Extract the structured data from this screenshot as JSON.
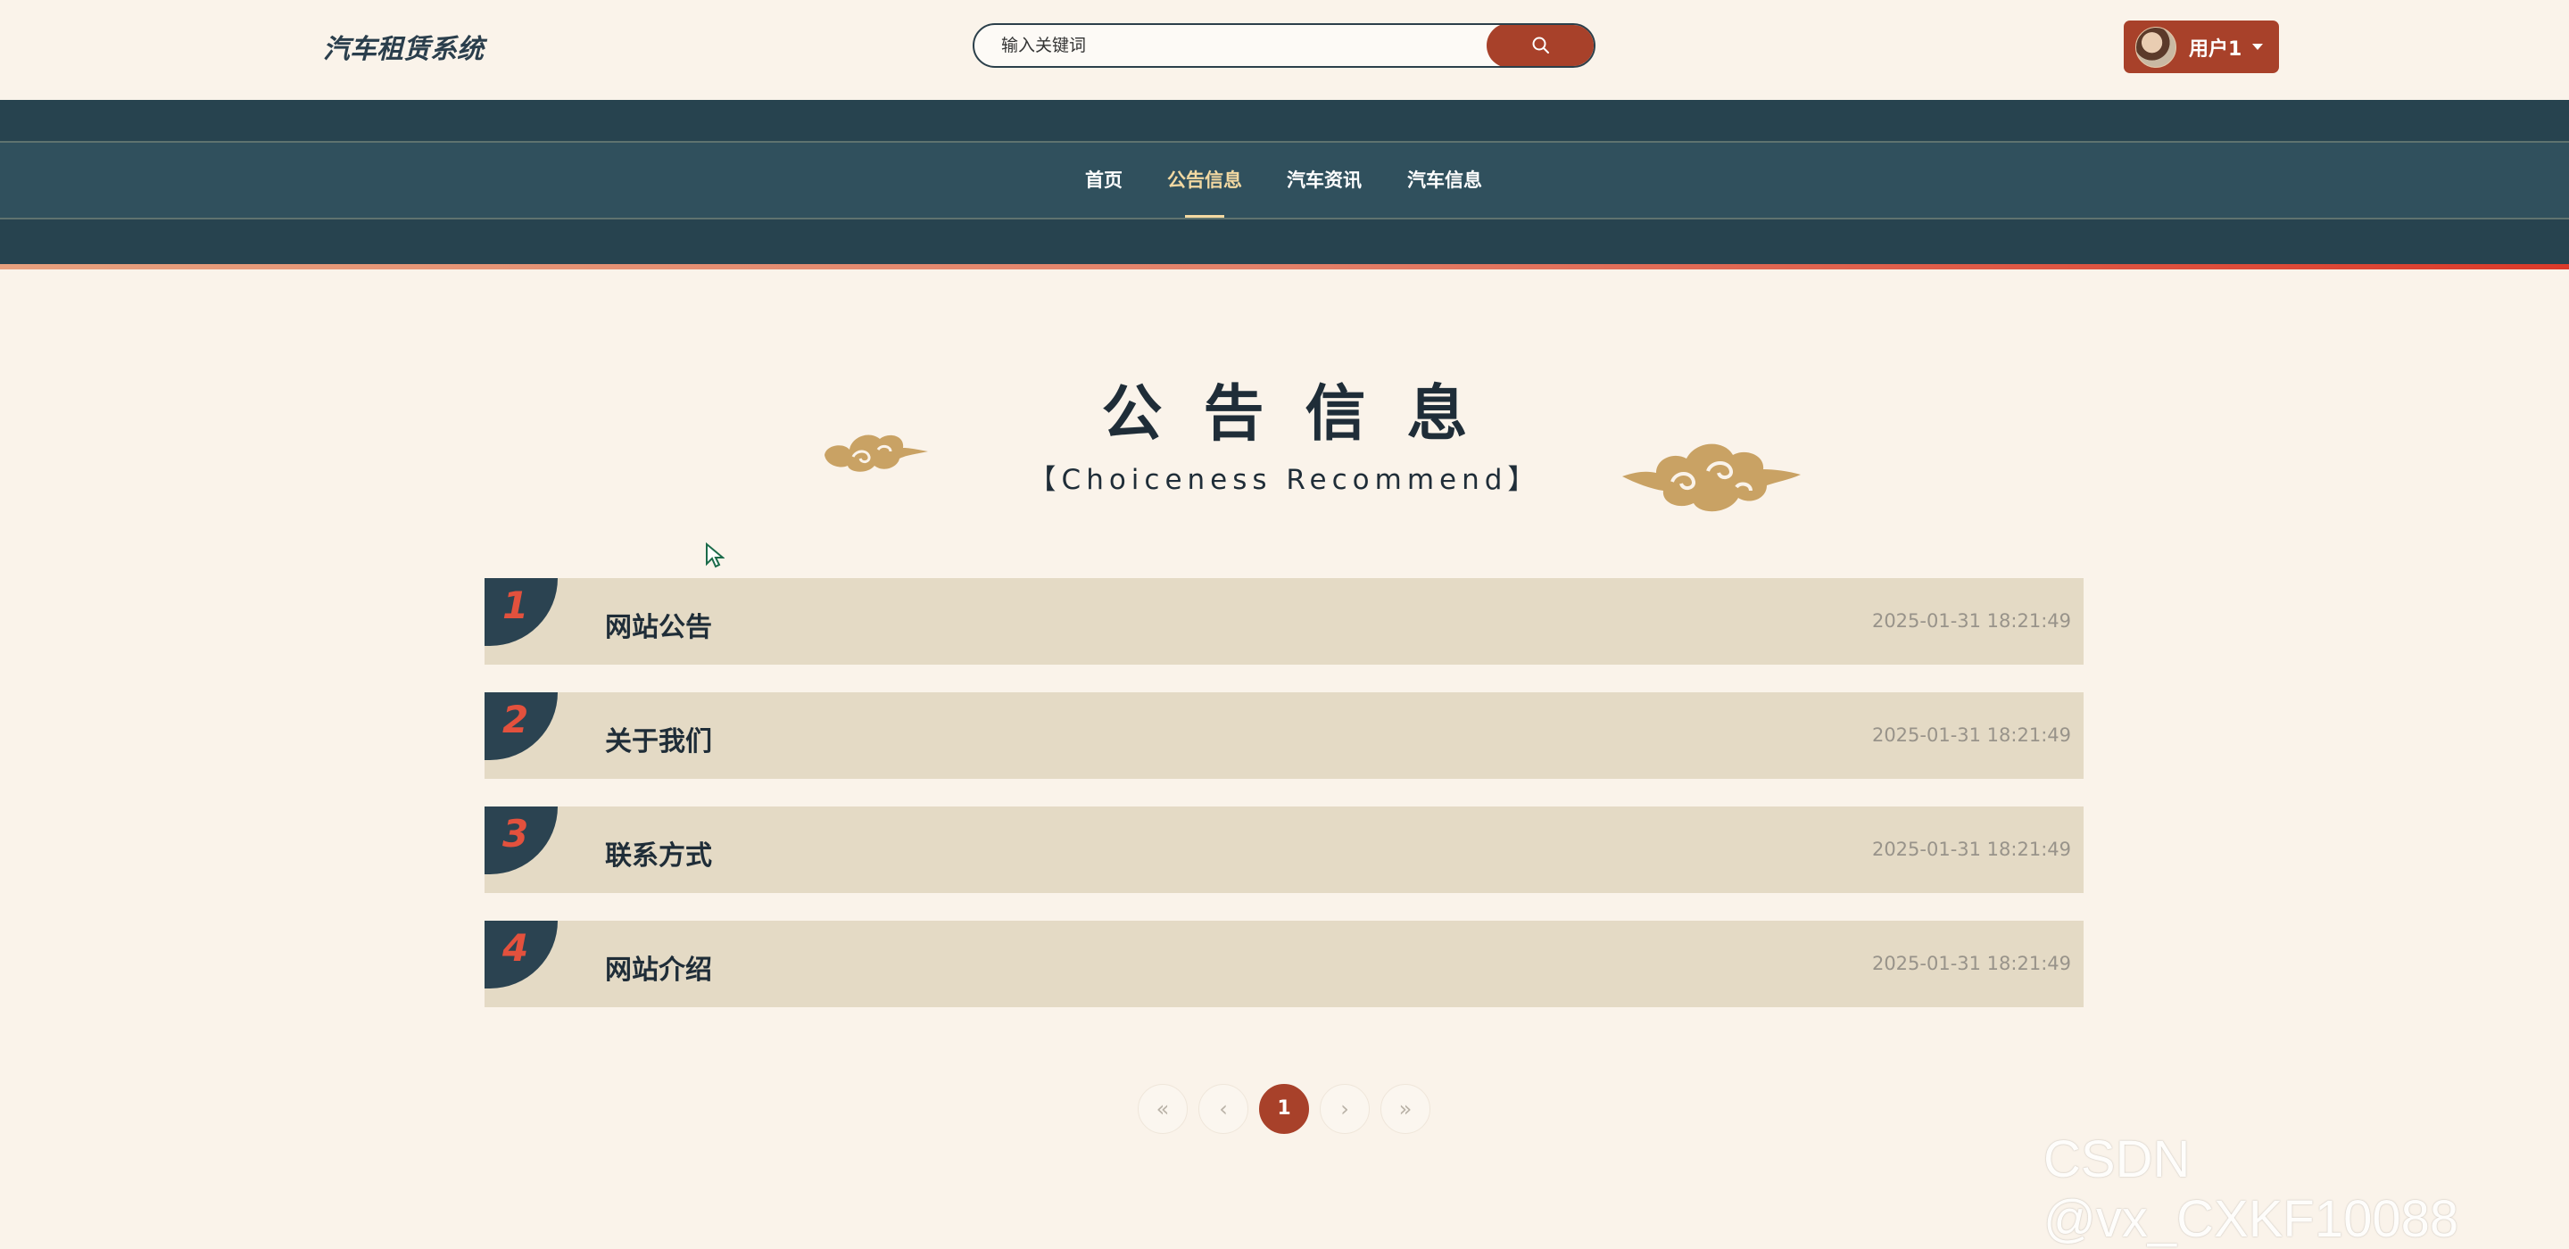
{
  "header": {
    "logo": "汽车租赁系统",
    "search": {
      "placeholder": "输入关键词",
      "value": ""
    },
    "user": {
      "name": "用户1"
    }
  },
  "nav": {
    "items": [
      {
        "label": "首页"
      },
      {
        "label": "公告信息"
      },
      {
        "label": "汽车资讯"
      },
      {
        "label": "汽车信息"
      }
    ],
    "active": "公告信息"
  },
  "section": {
    "title": "公告信息",
    "subtitle": "【Choiceness Recommend】"
  },
  "notices": [
    {
      "index": "1",
      "title": "网站公告",
      "date": "2025-01-31 18:21:49"
    },
    {
      "index": "2",
      "title": "关于我们",
      "date": "2025-01-31 18:21:49"
    },
    {
      "index": "3",
      "title": "联系方式",
      "date": "2025-01-31 18:21:49"
    },
    {
      "index": "4",
      "title": "网站介绍",
      "date": "2025-01-31 18:21:49"
    }
  ],
  "pagination": {
    "first": "«",
    "prev": "‹",
    "current": "1",
    "next": "›",
    "last": "»"
  },
  "watermark": "CSDN @vx_CXKF10088",
  "colors": {
    "accent": "#a8412a",
    "nav_bg": "#27434f",
    "page_bg": "#faf3ea",
    "card_bg": "#e4dac5",
    "badge_num": "#e3513d",
    "cloud": "#c9a264"
  },
  "icons": {
    "search": "search-icon",
    "caret": "chevron-down-icon",
    "cloud": "cloud-ornament-icon"
  }
}
